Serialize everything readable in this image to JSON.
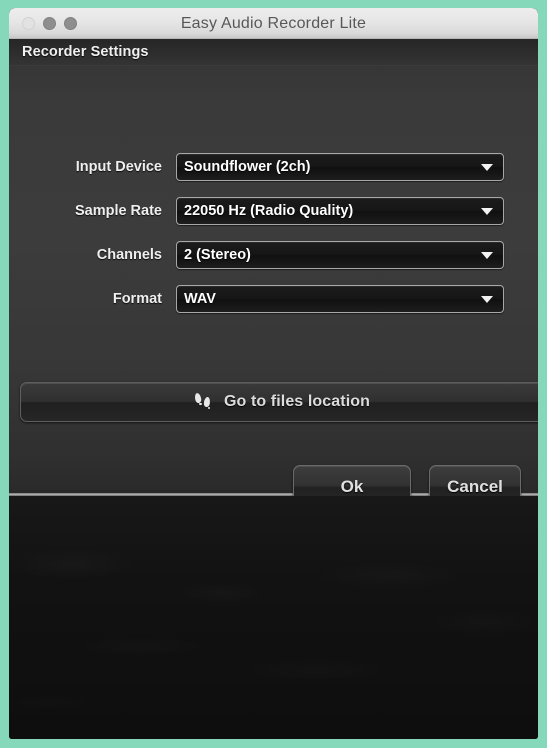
{
  "window": {
    "title": "Easy Audio Recorder Lite",
    "frame_color": "#86d8bb",
    "traffic_lights": [
      {
        "name": "close",
        "color": "#e2e2e2"
      },
      {
        "name": "minimize",
        "color": "#8e8e8e"
      },
      {
        "name": "zoom",
        "color": "#8e8e8e"
      }
    ]
  },
  "panel": {
    "header_title": "Recorder Settings",
    "rows": [
      {
        "label": "Input Device",
        "value": "Soundflower (2ch)"
      },
      {
        "label": "Sample Rate",
        "value": "22050 Hz (Radio Quality)"
      },
      {
        "label": "Channels",
        "value": "2 (Stereo)"
      },
      {
        "label": "Format",
        "value": "WAV"
      }
    ],
    "files_button": {
      "label": "Go to files location",
      "icon": "footprints-icon"
    },
    "actions": {
      "ok_label": "Ok",
      "cancel_label": "Cancel"
    }
  }
}
